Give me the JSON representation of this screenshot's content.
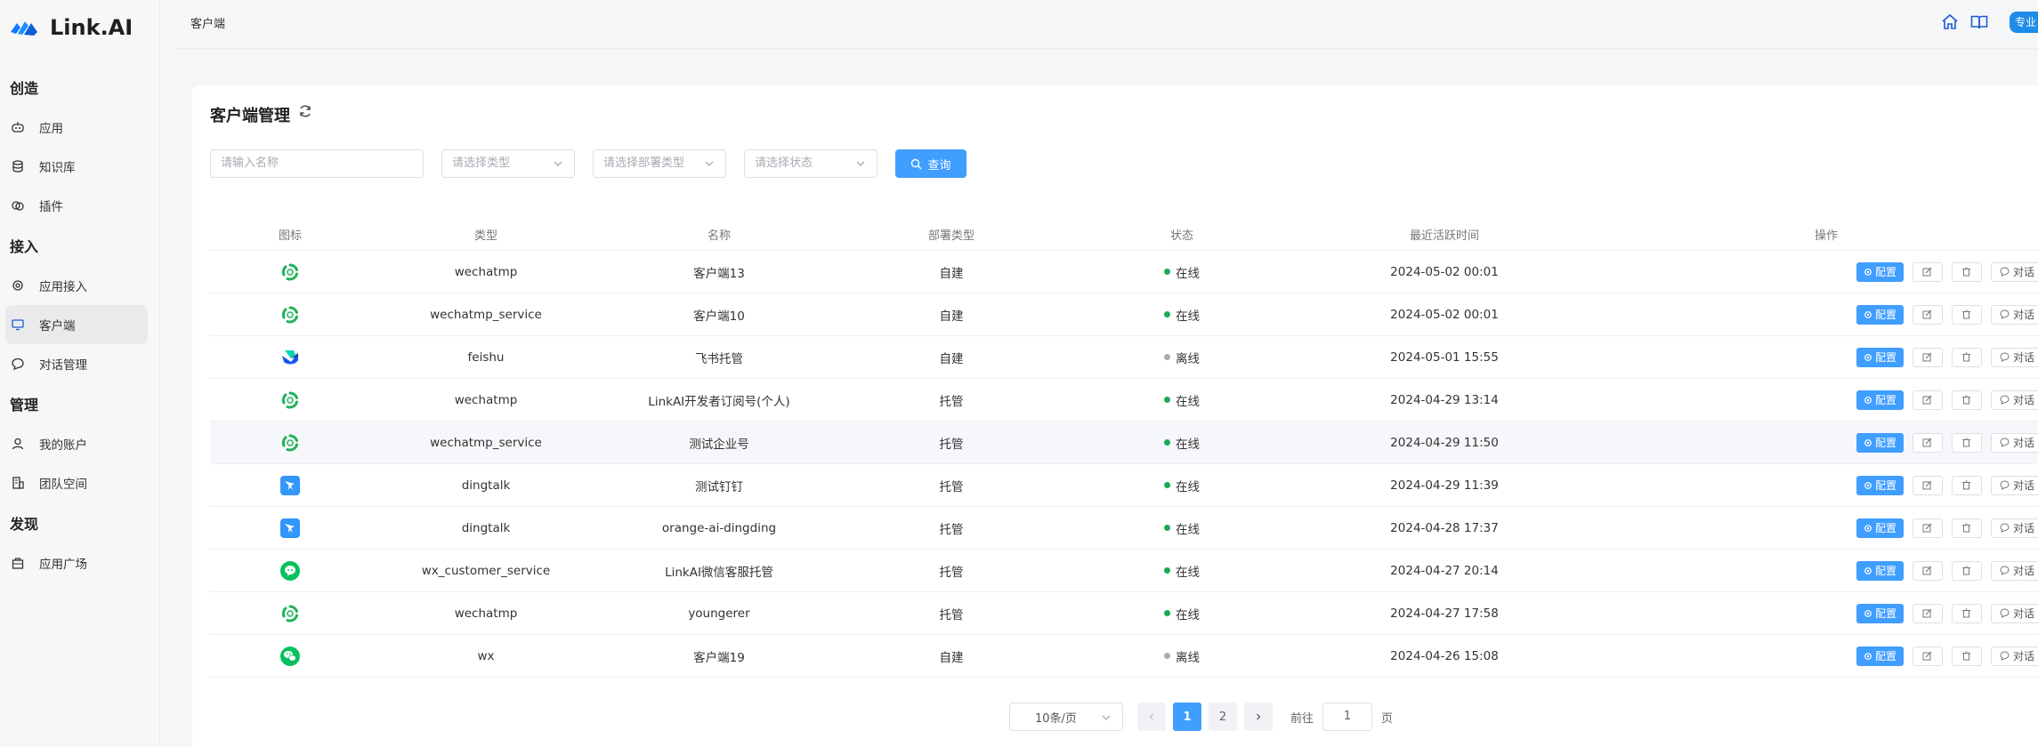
{
  "brand": {
    "name": "Link.AI"
  },
  "sidebar": {
    "sections": [
      {
        "title": "创造",
        "items": [
          {
            "label": "应用",
            "icon": "robot-icon"
          },
          {
            "label": "知识库",
            "icon": "database-icon"
          },
          {
            "label": "插件",
            "icon": "plugin-icon"
          }
        ]
      },
      {
        "title": "接入",
        "items": [
          {
            "label": "应用接入",
            "icon": "chip-icon"
          },
          {
            "label": "客户端",
            "icon": "monitor-icon",
            "active": true
          },
          {
            "label": "对话管理",
            "icon": "chat-icon"
          }
        ]
      },
      {
        "title": "管理",
        "items": [
          {
            "label": "我的账户",
            "icon": "user-icon"
          },
          {
            "label": "团队空间",
            "icon": "building-icon"
          }
        ]
      },
      {
        "title": "发现",
        "items": [
          {
            "label": "应用广场",
            "icon": "store-icon"
          }
        ]
      }
    ]
  },
  "topbar": {
    "breadcrumb": "客户端",
    "right_button": "专业"
  },
  "page": {
    "title": "客户端管理",
    "filters": {
      "name_placeholder": "请输入名称",
      "type_placeholder": "请选择类型",
      "deploy_placeholder": "请选择部署类型",
      "status_placeholder": "请选择状态",
      "query_label": "查询"
    },
    "columns": [
      "图标",
      "类型",
      "名称",
      "部署类型",
      "状态",
      "最近活跃时间",
      "操作"
    ],
    "ops": {
      "config": "配置",
      "chat": "对话"
    },
    "rows": [
      {
        "icon": "wechatmp-icon",
        "type": "wechatmp",
        "name": "客户端13",
        "deploy": "自建",
        "status": "在线",
        "online": true,
        "time": "2024-05-02 00:01"
      },
      {
        "icon": "wechatmp-icon",
        "type": "wechatmp_service",
        "name": "客户端10",
        "deploy": "自建",
        "status": "在线",
        "online": true,
        "time": "2024-05-02 00:01"
      },
      {
        "icon": "feishu-icon",
        "type": "feishu",
        "name": "飞书托管",
        "deploy": "自建",
        "status": "离线",
        "online": false,
        "time": "2024-05-01 15:55"
      },
      {
        "icon": "wechatmp-icon",
        "type": "wechatmp",
        "name": "LinkAI开发者订阅号(个人)",
        "deploy": "托管",
        "status": "在线",
        "online": true,
        "time": "2024-04-29 13:14"
      },
      {
        "icon": "wechatmp-icon",
        "type": "wechatmp_service",
        "name": "测试企业号",
        "deploy": "托管",
        "status": "在线",
        "online": true,
        "time": "2024-04-29 11:50"
      },
      {
        "icon": "dingtalk-icon",
        "type": "dingtalk",
        "name": "测试钉钉",
        "deploy": "托管",
        "status": "在线",
        "online": true,
        "time": "2024-04-29 11:39"
      },
      {
        "icon": "dingtalk-icon",
        "type": "dingtalk",
        "name": "orange-ai-dingding",
        "deploy": "托管",
        "status": "在线",
        "online": true,
        "time": "2024-04-28 17:37"
      },
      {
        "icon": "wx-service-icon",
        "type": "wx_customer_service",
        "name": "LinkAI微信客服托管",
        "deploy": "托管",
        "status": "在线",
        "online": true,
        "time": "2024-04-27 20:14"
      },
      {
        "icon": "wechatmp-icon",
        "type": "wechatmp",
        "name": "youngerer",
        "deploy": "托管",
        "status": "在线",
        "online": true,
        "time": "2024-04-27 17:58"
      },
      {
        "icon": "wechat-icon",
        "type": "wx",
        "name": "客户端19",
        "deploy": "自建",
        "status": "离线",
        "online": false,
        "time": "2024-04-26 15:08"
      }
    ],
    "pagination": {
      "page_size": "10条/页",
      "pages": [
        "1",
        "2"
      ],
      "current": "1",
      "goto_prefix": "前往",
      "goto_value": "1",
      "goto_suffix": "页"
    }
  },
  "colors": {
    "accent": "#409eff",
    "online": "#1aaa55",
    "offline": "#a8abb2"
  }
}
